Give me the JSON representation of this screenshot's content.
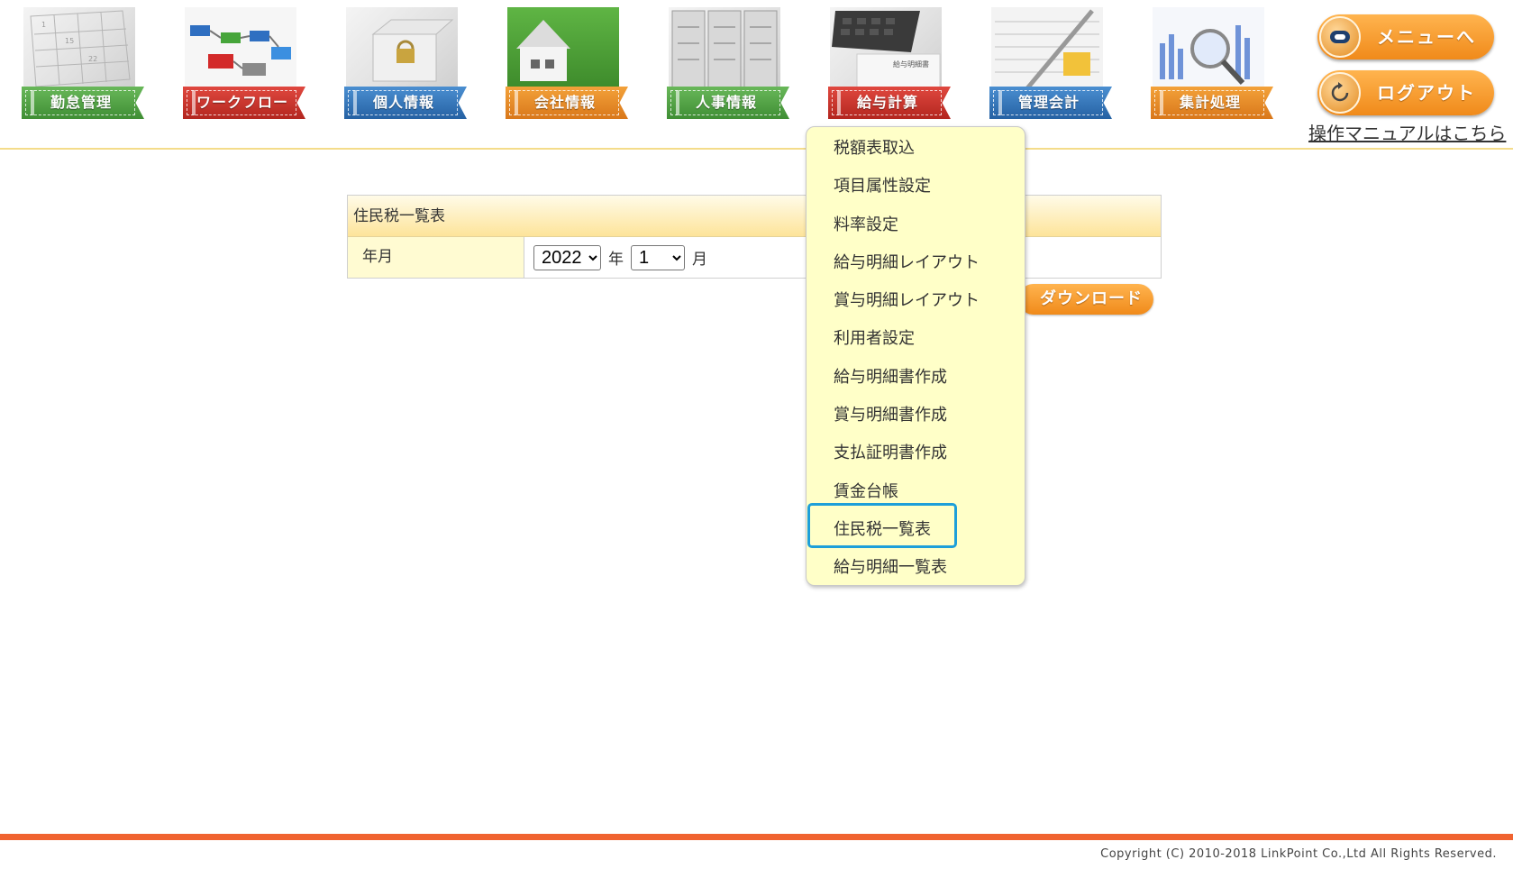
{
  "nav": [
    {
      "label": "勤怠管理",
      "color": "#4e9f42",
      "icon": "calendar-icon"
    },
    {
      "label": "ワークフロー",
      "color": "#c8322a",
      "icon": "flow-blocks-icon"
    },
    {
      "label": "個人情報",
      "color": "#336fb5",
      "icon": "lock-box-icon"
    },
    {
      "label": "会社情報",
      "color": "#e2871f",
      "icon": "house-icon"
    },
    {
      "label": "人事情報",
      "color": "#4e9f42",
      "icon": "cabinet-icon"
    },
    {
      "label": "給与計算",
      "color": "#c8322a",
      "icon": "calculator-icon"
    },
    {
      "label": "管理会計",
      "color": "#336fb5",
      "icon": "ledger-pen-icon"
    },
    {
      "label": "集計処理",
      "color": "#e2871f",
      "icon": "magnifier-chart-icon"
    }
  ],
  "header": {
    "menu_label": "メニューへ",
    "logout_label": "ログアウト",
    "manual_link": "操作マニュアルはこちら"
  },
  "form": {
    "title": "住民税一覧表",
    "row_label": "年月",
    "year_value": "2022",
    "year_unit": "年",
    "month_value": "1",
    "month_unit": "月",
    "download_label": "ダウンロード"
  },
  "dropdown": {
    "items": [
      "税額表取込",
      "項目属性設定",
      "料率設定",
      "給与明細レイアウト",
      "賞与明細レイアウト",
      "利用者設定",
      "給与明細書作成",
      "賞与明細書作成",
      "支払証明書作成",
      "賃金台帳",
      "住民税一覧表",
      "給与明細一覧表"
    ],
    "highlighted": "住民税一覧表"
  },
  "footer": {
    "copyright": "Copyright (C) 2010-2018 LinkPoint Co.,Ltd All Rights Reserved."
  },
  "colors": {
    "accent_orange": "#f08a1a",
    "footer_bar": "#f06330",
    "highlight_border": "#1e9fd9",
    "dropdown_bg": "#ffffc8"
  }
}
